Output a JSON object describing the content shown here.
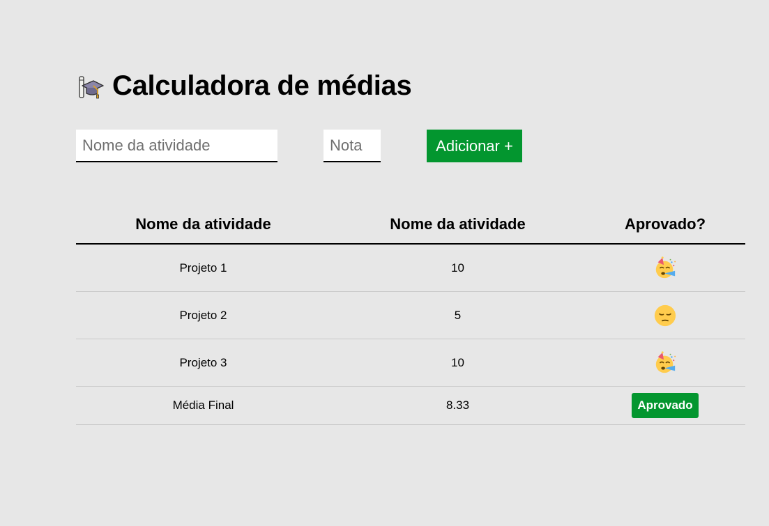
{
  "header": {
    "icon": "graduation-cap-icon",
    "title": "Calculadora de médias"
  },
  "form": {
    "activity_placeholder": "Nome da atividade",
    "activity_value": "",
    "grade_placeholder": "Nota",
    "grade_value": "",
    "add_label": "Adicionar +"
  },
  "table": {
    "headers": [
      "Nome da atividade",
      "Nome da atividade",
      "Aprovado?"
    ],
    "rows": [
      {
        "activity": "Projeto 1",
        "grade": "10",
        "status_icon": "party-face-icon"
      },
      {
        "activity": "Projeto 2",
        "grade": "5",
        "status_icon": "sad-face-icon"
      },
      {
        "activity": "Projeto 3",
        "grade": "10",
        "status_icon": "party-face-icon"
      }
    ],
    "footer": {
      "label": "Média Final",
      "average": "8.33",
      "result": "Aprovado"
    }
  },
  "colors": {
    "background": "#e7e7e7",
    "accent_green": "#03962f",
    "text": "#000000"
  }
}
